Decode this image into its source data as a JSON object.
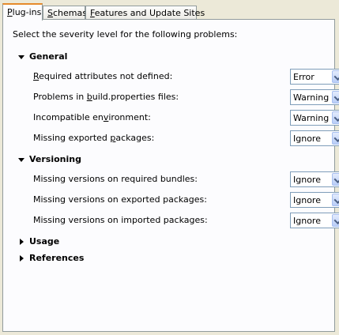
{
  "tabs": [
    {
      "label_u": "P",
      "label_rest": "lug-ins",
      "active": true
    },
    {
      "label_u": "S",
      "label_rest": "chemas",
      "active": false
    },
    {
      "label_u": "F",
      "label_rest": "eatures and Update Sites",
      "active": false
    }
  ],
  "intro": "Select the severity level for the following problems:",
  "sections": {
    "general": {
      "label": "General",
      "expanded": true
    },
    "versioning": {
      "label": "Versioning",
      "expanded": true
    },
    "usage": {
      "label": "Usage",
      "expanded": false
    },
    "references": {
      "label": "References",
      "expanded": false
    }
  },
  "general_rows": [
    {
      "pre": "",
      "u": "R",
      "post": "equired attributes not defined:",
      "value": "Error"
    },
    {
      "pre": "Problems in ",
      "u": "b",
      "post": "uild.properties files:",
      "value": "Warning"
    },
    {
      "pre": "Incompatible en",
      "u": "v",
      "post": "ironment:",
      "value": "Warning"
    },
    {
      "pre": "Missing exported ",
      "u": "p",
      "post": "ackages:",
      "value": "Ignore"
    }
  ],
  "versioning_rows": [
    {
      "label": "Missing versions on required bundles:",
      "value": "Ignore"
    },
    {
      "label": "Missing versions on exported packages:",
      "value": "Ignore"
    },
    {
      "label": "Missing versions on imported packages:",
      "value": "Ignore"
    }
  ]
}
